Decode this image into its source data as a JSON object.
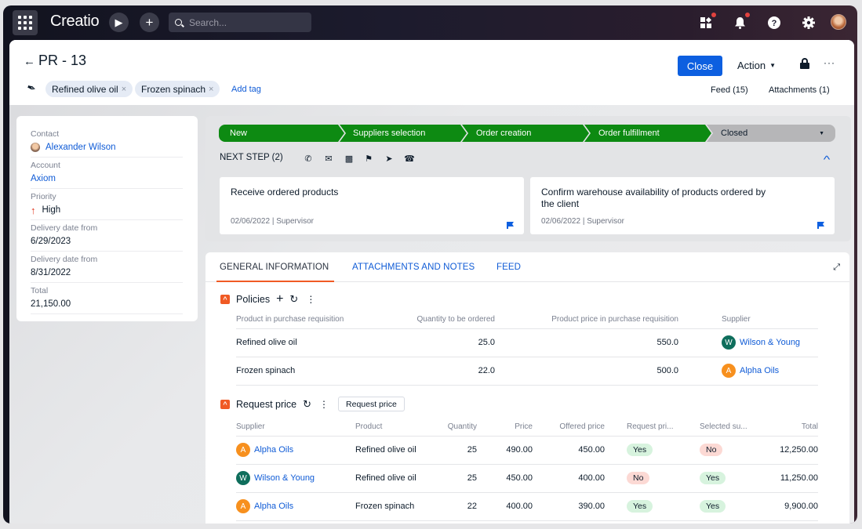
{
  "topbar": {
    "app_name": "Creatio",
    "search_placeholder": "Search...",
    "icons": [
      "apps-grid-icon",
      "play-icon",
      "plus-icon",
      "search-icon",
      "widgets-icon",
      "bell-icon",
      "help-icon",
      "gear-icon",
      "user-avatar"
    ]
  },
  "header": {
    "title": "PR - 13",
    "tags": [
      {
        "label": "Refined olive oil"
      },
      {
        "label": "Frozen spinach"
      }
    ],
    "add_tag": "Add tag",
    "close_label": "Close",
    "action_label": "Action",
    "feed_link": "Feed (15)",
    "attachments_link": "Attachments (1)"
  },
  "profile": {
    "fields": [
      {
        "label": "Contact",
        "value": "Alexander Wilson"
      },
      {
        "label": "Account",
        "value": "Axiom"
      },
      {
        "label": "Priority",
        "value": "High"
      },
      {
        "label": "Delivery date from",
        "value": "6/29/2023"
      },
      {
        "label": "Delivery date from",
        "value": "8/31/2022"
      },
      {
        "label": "Total",
        "value": "21,150.00"
      }
    ]
  },
  "stages": [
    {
      "label": "New",
      "state": "done"
    },
    {
      "label": "Suppliers selection",
      "state": "done"
    },
    {
      "label": "Order creation",
      "state": "done"
    },
    {
      "label": "Order fulfillment",
      "state": "done"
    },
    {
      "label": "Closed",
      "state": "pending"
    }
  ],
  "next_step": {
    "label": "NEXT STEP (2)",
    "tasks": [
      {
        "title": "Receive ordered products",
        "meta": "02/06/2022 | Supervisor"
      },
      {
        "title": "Confirm warehouse availability of products ordered by the client",
        "meta": "02/06/2022 | Supervisor"
      }
    ]
  },
  "tabs": [
    {
      "label": "GENERAL INFORMATION",
      "active": true
    },
    {
      "label": "ATTACHMENTS AND NOTES",
      "active": false
    },
    {
      "label": "FEED",
      "active": false
    }
  ],
  "policies": {
    "title": "Policies",
    "columns": [
      "Product in purchase requisition",
      "Quantity to be ordered",
      "Product price in purchase requisition",
      "Supplier"
    ],
    "rows": [
      {
        "product": "Refined olive oil",
        "qty": "25.0",
        "price": "550.0",
        "supplier": "Wilson & Young",
        "initial": "W",
        "color": "#0f6e5c"
      },
      {
        "product": "Frozen spinach",
        "qty": "22.0",
        "price": "500.0",
        "supplier": "Alpha Oils",
        "initial": "A",
        "color": "#f7901e"
      }
    ]
  },
  "request_price": {
    "title": "Request price",
    "button": "Request price",
    "columns": [
      "Supplier",
      "Product",
      "Quantity",
      "Price",
      "Offered price",
      "Request pri...",
      "Selected su...",
      "Total"
    ],
    "rows": [
      {
        "supplier": "Alpha Oils",
        "initial": "A",
        "color": "#f7901e",
        "product": "Refined olive oil",
        "qty": "25",
        "price": "490.00",
        "offered": "450.00",
        "request": "Yes",
        "selected": "No",
        "total": "12,250.00"
      },
      {
        "supplier": "Wilson & Young",
        "initial": "W",
        "color": "#0f6e5c",
        "product": "Refined olive oil",
        "qty": "25",
        "price": "450.00",
        "offered": "400.00",
        "request": "No",
        "selected": "Yes",
        "total": "11,250.00"
      },
      {
        "supplier": "Alpha Oils",
        "initial": "A",
        "color": "#f7901e",
        "product": "Frozen spinach",
        "qty": "22",
        "price": "400.00",
        "offered": "390.00",
        "request": "Yes",
        "selected": "Yes",
        "total": "9,900.00"
      }
    ]
  }
}
